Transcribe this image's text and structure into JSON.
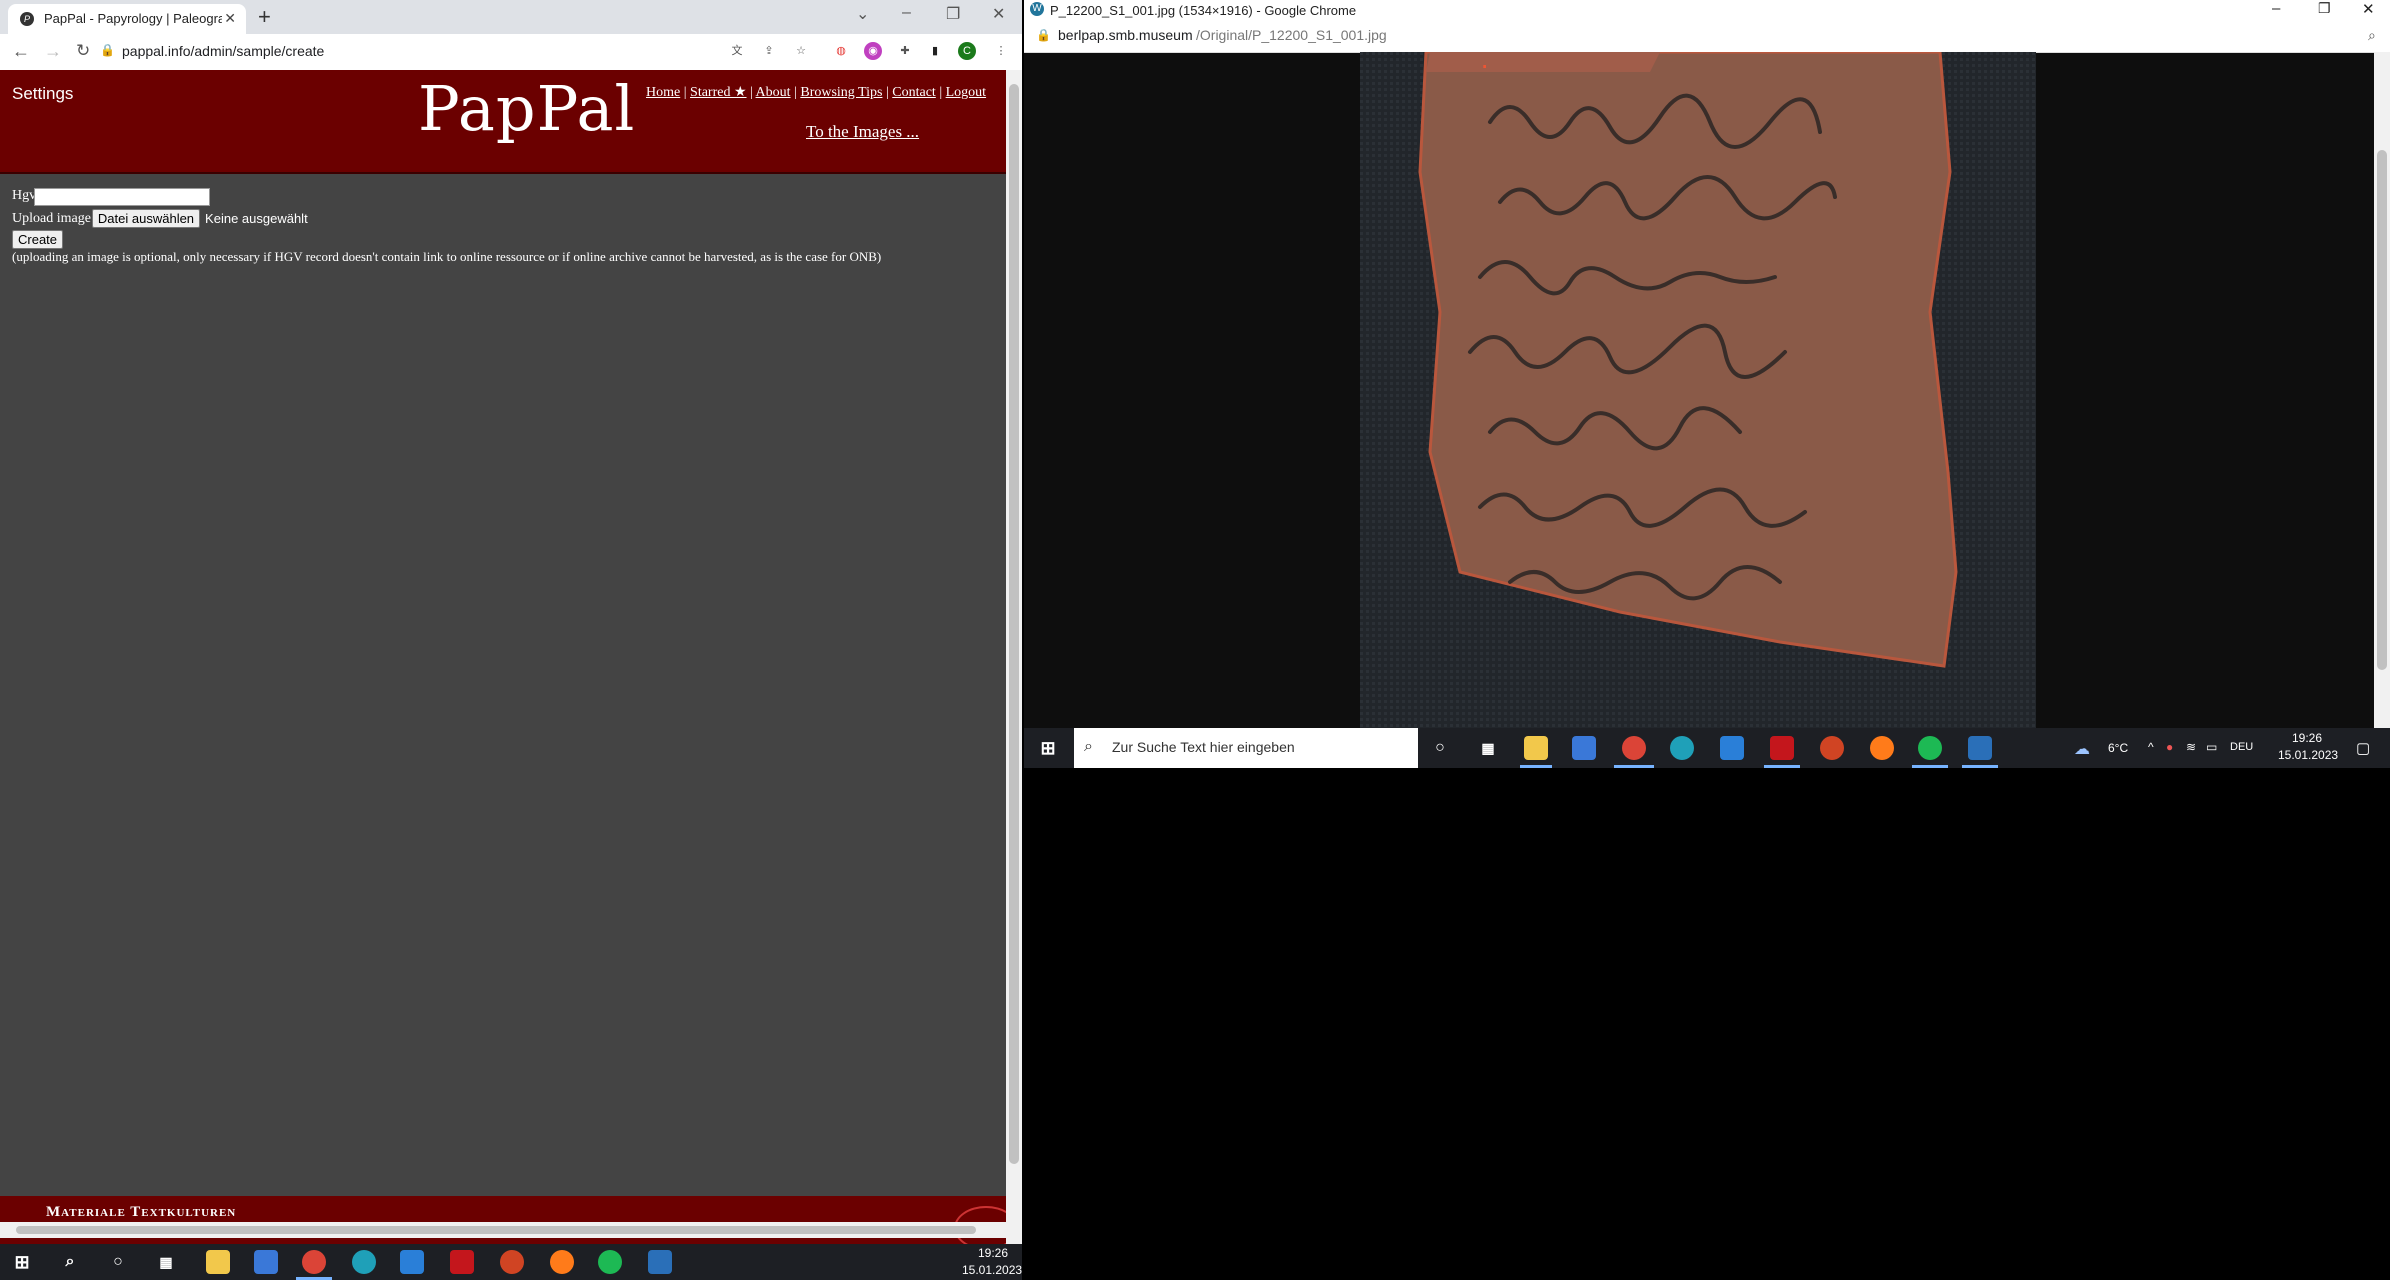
{
  "left_window": {
    "tab_title": "PapPal - Papyrology | Paleography",
    "url": "pappal.info/admin/sample/create",
    "profile_initial": "C",
    "page": {
      "settings_label": "Settings",
      "logo": "PapPal",
      "nav": [
        "Home",
        "Starred ★",
        "About",
        "Browsing Tips",
        "Contact",
        "Logout"
      ],
      "to_images": "To the Images ...",
      "form": {
        "hgv_label": "Hgv",
        "hgv_value": "",
        "upload_label": "Upload image",
        "file_button": "Datei auswählen",
        "file_status": "Keine ausgewählt",
        "create_button": "Create",
        "note": "(uploading an image is optional, only necessary if HGV record doesn't contain link to online ressource or if online archive cannot be harvested, as is the case for ONB)"
      },
      "footer_text": "Materiale Textkulturen"
    },
    "taskbar": {
      "time": "19:26",
      "date": "15.01.2023"
    }
  },
  "right_window": {
    "title": "P_12200_S1_001.jpg (1534×1916) - Google Chrome",
    "url_host": "berlpap.smb.museum",
    "url_path": "/Original/P_12200_S1_001.jpg",
    "image_alt": "Papyrus fragment with handwritten Greek text",
    "taskbar": {
      "search_placeholder": "Zur Suche Text hier eingeben",
      "weather": "6°C",
      "language": "DEU",
      "time": "19:26",
      "date": "15.01.2023"
    }
  },
  "colors": {
    "banner": "#6b0000",
    "page_bg": "#444444",
    "taskbar": "#1d1f24"
  }
}
